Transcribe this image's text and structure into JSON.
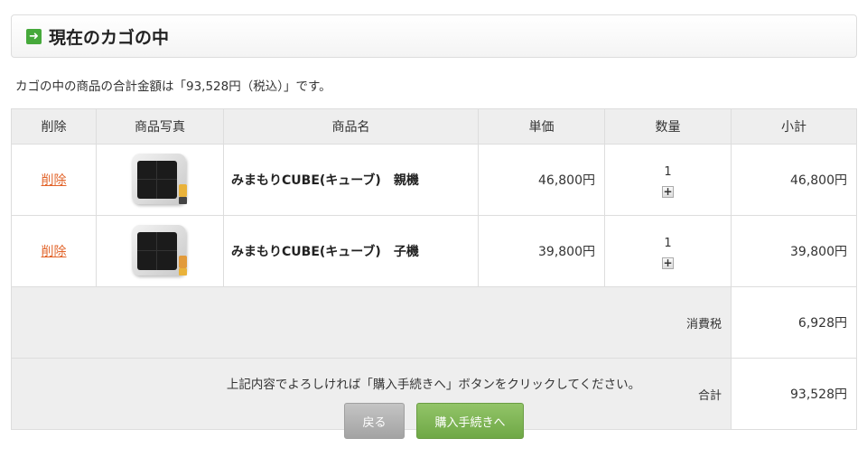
{
  "header": {
    "title": "現在のカゴの中",
    "icon": "arrow-right-icon",
    "icon_glyph": "➜",
    "icon_color": "#46a93b"
  },
  "summary_text": "カゴの中の商品の合計金額は「93,528円（税込）」です。",
  "table": {
    "columns": [
      "削除",
      "商品写真",
      "商品名",
      "単価",
      "数量",
      "小計"
    ],
    "items": [
      {
        "delete_label": "削除",
        "name": "みまもりCUBE(キューブ)　親機",
        "price": "46,800円",
        "quantity": "1",
        "subtotal": "46,800円"
      },
      {
        "delete_label": "削除",
        "name": "みまもりCUBE(キューブ)　子機",
        "price": "39,800円",
        "quantity": "1",
        "subtotal": "39,800円"
      }
    ],
    "tax_label": "消費税",
    "tax_value": "6,928円",
    "total_label": "合計",
    "total_value": "93,528円"
  },
  "notice_text": "上記内容でよろしければ「購入手続きへ」ボタンをクリックしてください。",
  "buttons": {
    "back_label": "戻る",
    "purchase_label": "購入手続きへ"
  },
  "colors": {
    "link": "#e2642a",
    "accent_green": "#6fa846",
    "back_gray": "#a3a3a3"
  }
}
